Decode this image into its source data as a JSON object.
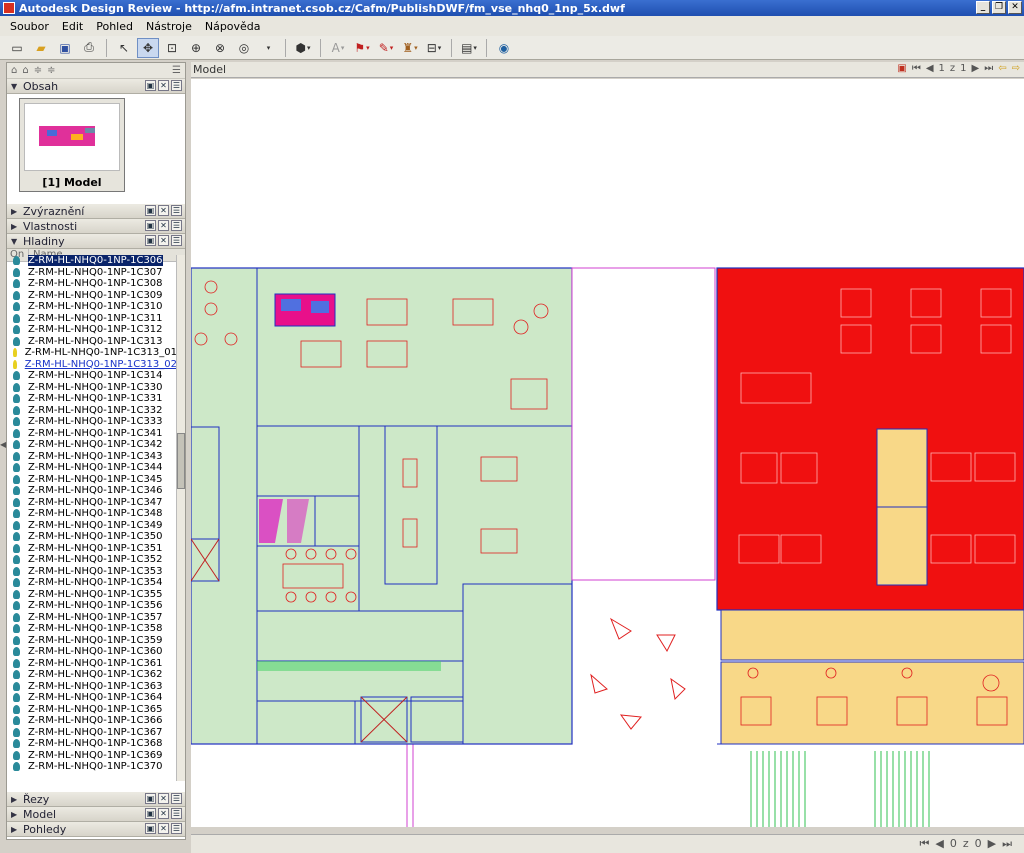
{
  "window": {
    "title": "Autodesk Design Review - http://afm.intranet.csob.cz/Cafm/PublishDWF/fm_vse_nhq0_1np_5x.dwf"
  },
  "menu": [
    "Soubor",
    "Edit",
    "Pohled",
    "Nástroje",
    "Nápověda"
  ],
  "toolbar_icons": [
    "new-icon",
    "open-icon",
    "save-icon",
    "print-icon",
    "select-icon",
    "pan-icon",
    "zoom-window-icon",
    "zoom-icon",
    "fit-icon",
    "orbit-icon",
    "view-cube-icon",
    "text-icon",
    "callout-icon",
    "markup-icon",
    "stamp-icon",
    "measure-icon",
    "layout-icon",
    "globe-icon"
  ],
  "panels": {
    "content": {
      "title": "Obsah",
      "thumb_label": "[1] Model"
    },
    "highlight": {
      "title": "Zvýraznění"
    },
    "properties": {
      "title": "Vlastnosti"
    },
    "layers": {
      "title": "Hladiny",
      "col_on": "On",
      "col_name": "Name",
      "items": [
        {
          "name": "Z-RM-HL-NHQ0-1NP-1C306",
          "state": "selected"
        },
        {
          "name": "Z-RM-HL-NHQ0-1NP-1C307"
        },
        {
          "name": "Z-RM-HL-NHQ0-1NP-1C308"
        },
        {
          "name": "Z-RM-HL-NHQ0-1NP-1C309"
        },
        {
          "name": "Z-RM-HL-NHQ0-1NP-1C310"
        },
        {
          "name": "Z-RM-HL-NHQ0-1NP-1C311"
        },
        {
          "name": "Z-RM-HL-NHQ0-1NP-1C312"
        },
        {
          "name": "Z-RM-HL-NHQ0-1NP-1C313"
        },
        {
          "name": "Z-RM-HL-NHQ0-1NP-1C313_01",
          "bulb": "yellow"
        },
        {
          "name": "Z-RM-HL-NHQ0-1NP-1C313_02",
          "bulb": "yellow",
          "link": true
        },
        {
          "name": "Z-RM-HL-NHQ0-1NP-1C314"
        },
        {
          "name": "Z-RM-HL-NHQ0-1NP-1C330"
        },
        {
          "name": "Z-RM-HL-NHQ0-1NP-1C331"
        },
        {
          "name": "Z-RM-HL-NHQ0-1NP-1C332"
        },
        {
          "name": "Z-RM-HL-NHQ0-1NP-1C333"
        },
        {
          "name": "Z-RM-HL-NHQ0-1NP-1C341"
        },
        {
          "name": "Z-RM-HL-NHQ0-1NP-1C342"
        },
        {
          "name": "Z-RM-HL-NHQ0-1NP-1C343"
        },
        {
          "name": "Z-RM-HL-NHQ0-1NP-1C344"
        },
        {
          "name": "Z-RM-HL-NHQ0-1NP-1C345"
        },
        {
          "name": "Z-RM-HL-NHQ0-1NP-1C346"
        },
        {
          "name": "Z-RM-HL-NHQ0-1NP-1C347"
        },
        {
          "name": "Z-RM-HL-NHQ0-1NP-1C348"
        },
        {
          "name": "Z-RM-HL-NHQ0-1NP-1C349"
        },
        {
          "name": "Z-RM-HL-NHQ0-1NP-1C350"
        },
        {
          "name": "Z-RM-HL-NHQ0-1NP-1C351"
        },
        {
          "name": "Z-RM-HL-NHQ0-1NP-1C352"
        },
        {
          "name": "Z-RM-HL-NHQ0-1NP-1C353"
        },
        {
          "name": "Z-RM-HL-NHQ0-1NP-1C354"
        },
        {
          "name": "Z-RM-HL-NHQ0-1NP-1C355"
        },
        {
          "name": "Z-RM-HL-NHQ0-1NP-1C356"
        },
        {
          "name": "Z-RM-HL-NHQ0-1NP-1C357"
        },
        {
          "name": "Z-RM-HL-NHQ0-1NP-1C358"
        },
        {
          "name": "Z-RM-HL-NHQ0-1NP-1C359"
        },
        {
          "name": "Z-RM-HL-NHQ0-1NP-1C360"
        },
        {
          "name": "Z-RM-HL-NHQ0-1NP-1C361"
        },
        {
          "name": "Z-RM-HL-NHQ0-1NP-1C362"
        },
        {
          "name": "Z-RM-HL-NHQ0-1NP-1C363"
        },
        {
          "name": "Z-RM-HL-NHQ0-1NP-1C364"
        },
        {
          "name": "Z-RM-HL-NHQ0-1NP-1C365"
        },
        {
          "name": "Z-RM-HL-NHQ0-1NP-1C366"
        },
        {
          "name": "Z-RM-HL-NHQ0-1NP-1C367"
        },
        {
          "name": "Z-RM-HL-NHQ0-1NP-1C368"
        },
        {
          "name": "Z-RM-HL-NHQ0-1NP-1C369"
        },
        {
          "name": "Z-RM-HL-NHQ0-1NP-1C370"
        }
      ]
    },
    "sections": {
      "title": "Řezy"
    },
    "model": {
      "title": "Model"
    },
    "views": {
      "title": "Pohledy"
    }
  },
  "canvas": {
    "tab_label": "Model",
    "page_current": "1",
    "page_of": "z",
    "page_total": "1",
    "bottom_current": "0",
    "bottom_of": "z",
    "bottom_total": "0"
  },
  "colors": {
    "room_green": "#cde8c8",
    "room_red": "#f01010",
    "room_tan": "#f8d888",
    "line_blue": "#2030c0",
    "furniture_red": "#e02020"
  }
}
